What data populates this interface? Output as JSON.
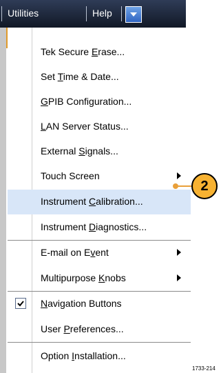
{
  "menubar": {
    "utilities_label": "Utilities",
    "help_label": "Help"
  },
  "menu": {
    "items": [
      {
        "label": "Tek Secure Erase...",
        "hotkey_index": 11
      },
      {
        "label": "Set Time & Date...",
        "hotkey_index": 4
      },
      {
        "label": "GPIB Configuration...",
        "hotkey_index": 0
      },
      {
        "label": "LAN Server Status...",
        "hotkey_index": 0
      },
      {
        "label": "External Signals...",
        "hotkey_index": 9
      },
      {
        "label": "Touch Screen",
        "hotkey_index": -1,
        "submenu": true
      },
      {
        "label": "Instrument Calibration...",
        "hotkey_index": 11,
        "highlighted": true
      },
      {
        "label": "Instrument Diagnostics...",
        "hotkey_index": 11
      },
      {
        "label": "E-mail on Event",
        "hotkey_index": 11,
        "submenu": true
      },
      {
        "label": "Multipurpose Knobs",
        "hotkey_index": 13,
        "submenu": true
      },
      {
        "label": "Navigation Buttons",
        "hotkey_index": 0,
        "checked": true
      },
      {
        "label": "User Preferences...",
        "hotkey_index": 5
      },
      {
        "label": "Option Installation...",
        "hotkey_index": 7
      }
    ]
  },
  "callout": {
    "number": "2",
    "color": "#f7b232"
  },
  "figure_id": "1733-214"
}
